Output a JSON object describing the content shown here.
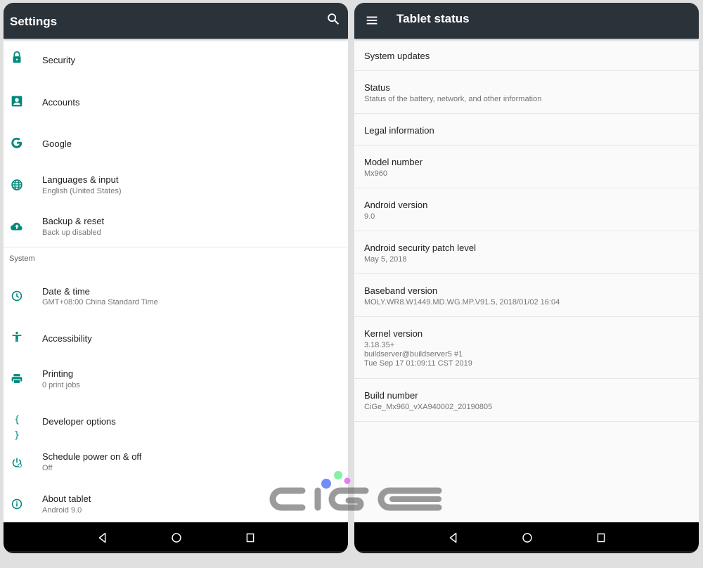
{
  "colors": {
    "accent": "#00897b",
    "appbar": "#2a323a",
    "navbar": "#000000",
    "primary_text": "#212121",
    "secondary_text": "#757575"
  },
  "left": {
    "title": "Settings",
    "search_icon": "search-icon",
    "items": [
      {
        "icon": "lock-icon",
        "title": "Security",
        "subtitle": ""
      },
      {
        "icon": "account-box-icon",
        "title": "Accounts",
        "subtitle": ""
      },
      {
        "icon": "google-icon",
        "title": "Google",
        "subtitle": ""
      },
      {
        "icon": "globe-icon",
        "title": "Languages & input",
        "subtitle": "English (United States)"
      },
      {
        "icon": "cloud-upload-icon",
        "title": "Backup & reset",
        "subtitle": "Back up disabled"
      }
    ],
    "section_header": "System",
    "system_items": [
      {
        "icon": "clock-icon",
        "title": "Date & time",
        "subtitle": "GMT+08:00 China Standard Time"
      },
      {
        "icon": "accessibility-icon",
        "title": "Accessibility",
        "subtitle": ""
      },
      {
        "icon": "printer-icon",
        "title": "Printing",
        "subtitle": "0 print jobs"
      },
      {
        "icon": "braces-icon",
        "title": "Developer options",
        "subtitle": ""
      },
      {
        "icon": "schedule-power-icon",
        "title": "Schedule power on & off",
        "subtitle": "Off"
      },
      {
        "icon": "info-icon",
        "title": "About tablet",
        "subtitle": "Android 9.0"
      }
    ]
  },
  "right": {
    "title": "Tablet status",
    "menu_icon": "hamburger-menu-icon",
    "items": [
      {
        "title": "System updates",
        "subtitle": []
      },
      {
        "title": "Status",
        "subtitle": [
          "Status of the battery, network, and other information"
        ]
      },
      {
        "title": "Legal information",
        "subtitle": []
      },
      {
        "title": "Model number",
        "subtitle": [
          "Mx960"
        ]
      },
      {
        "title": "Android version",
        "subtitle": [
          "9.0"
        ]
      },
      {
        "title": "Android security patch level",
        "subtitle": [
          "May 5, 2018"
        ]
      },
      {
        "title": "Baseband version",
        "subtitle": [
          "MOLY.WR8.W1449.MD.WG.MP.V91.5, 2018/01/02 16:04"
        ]
      },
      {
        "title": "Kernel version",
        "subtitle": [
          "3.18.35+",
          "buildserver@buildserver5 #1",
          "Tue Sep 17 01:09:11 CST 2019"
        ]
      },
      {
        "title": "Build number",
        "subtitle": [
          "CiGe_Mx960_vXA940002_20190805"
        ]
      }
    ]
  },
  "navbar": {
    "buttons": [
      "back",
      "home",
      "recents"
    ]
  },
  "watermark": {
    "text": "CIGE",
    "dot_colors": [
      "#6f8ff7",
      "#84f0a4",
      "#e57ef0"
    ]
  }
}
